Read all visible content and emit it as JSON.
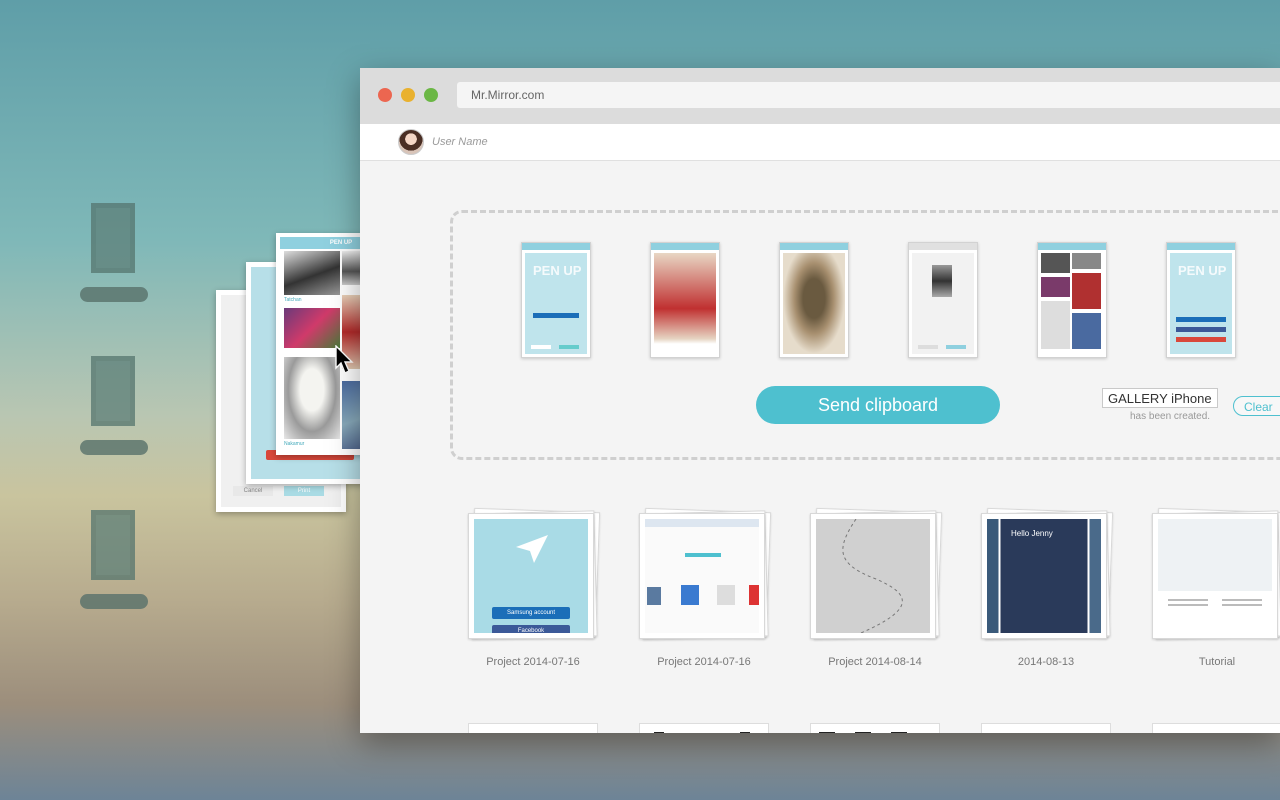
{
  "desktop": {
    "icons": [
      {
        "name": "desktop-file-1"
      },
      {
        "name": "desktop-file-2"
      },
      {
        "name": "desktop-file-3"
      }
    ]
  },
  "drag_stack": {
    "app_title": "PEN  UP",
    "front_caption_1": "Tatchan",
    "front_caption_2": "Nakamur",
    "back_cancel": "Cancel",
    "back_print": "Print"
  },
  "window": {
    "url": "Mr.Mirror.com",
    "user_name": "User Name",
    "clipboard": {
      "send_label": "Send clipboard",
      "gallery_value": "GALLERY iPhone",
      "created_text": "has been created.",
      "clear_label": "Clear",
      "thumbs": [
        {
          "name": "clip-thumb-penup-login",
          "caption": "PEN UP"
        },
        {
          "name": "clip-thumb-red-dress",
          "caption": ""
        },
        {
          "name": "clip-thumb-creature",
          "caption": ""
        },
        {
          "name": "clip-thumb-print-dialog",
          "caption": ""
        },
        {
          "name": "clip-thumb-gallery-grid",
          "caption": ""
        },
        {
          "name": "clip-thumb-penup-social",
          "caption": "PEN UP"
        }
      ]
    },
    "projects": [
      {
        "caption": "Project 2014-07-16",
        "kind": "penup",
        "btn1": "Samsung account",
        "btn2": "Facebook"
      },
      {
        "caption": "Project 2014-07-16",
        "kind": "web"
      },
      {
        "caption": "Project 2014-08-14",
        "kind": "path"
      },
      {
        "caption": "2014-08-13",
        "kind": "phone",
        "greeting": "Hello Jenny"
      },
      {
        "caption": "Tutorial",
        "kind": "tutorial"
      }
    ]
  },
  "colors": {
    "accent": "#4ec0cf",
    "traffic_red": "#ec6650",
    "traffic_yellow": "#e9b12f",
    "traffic_green": "#6bb745"
  }
}
